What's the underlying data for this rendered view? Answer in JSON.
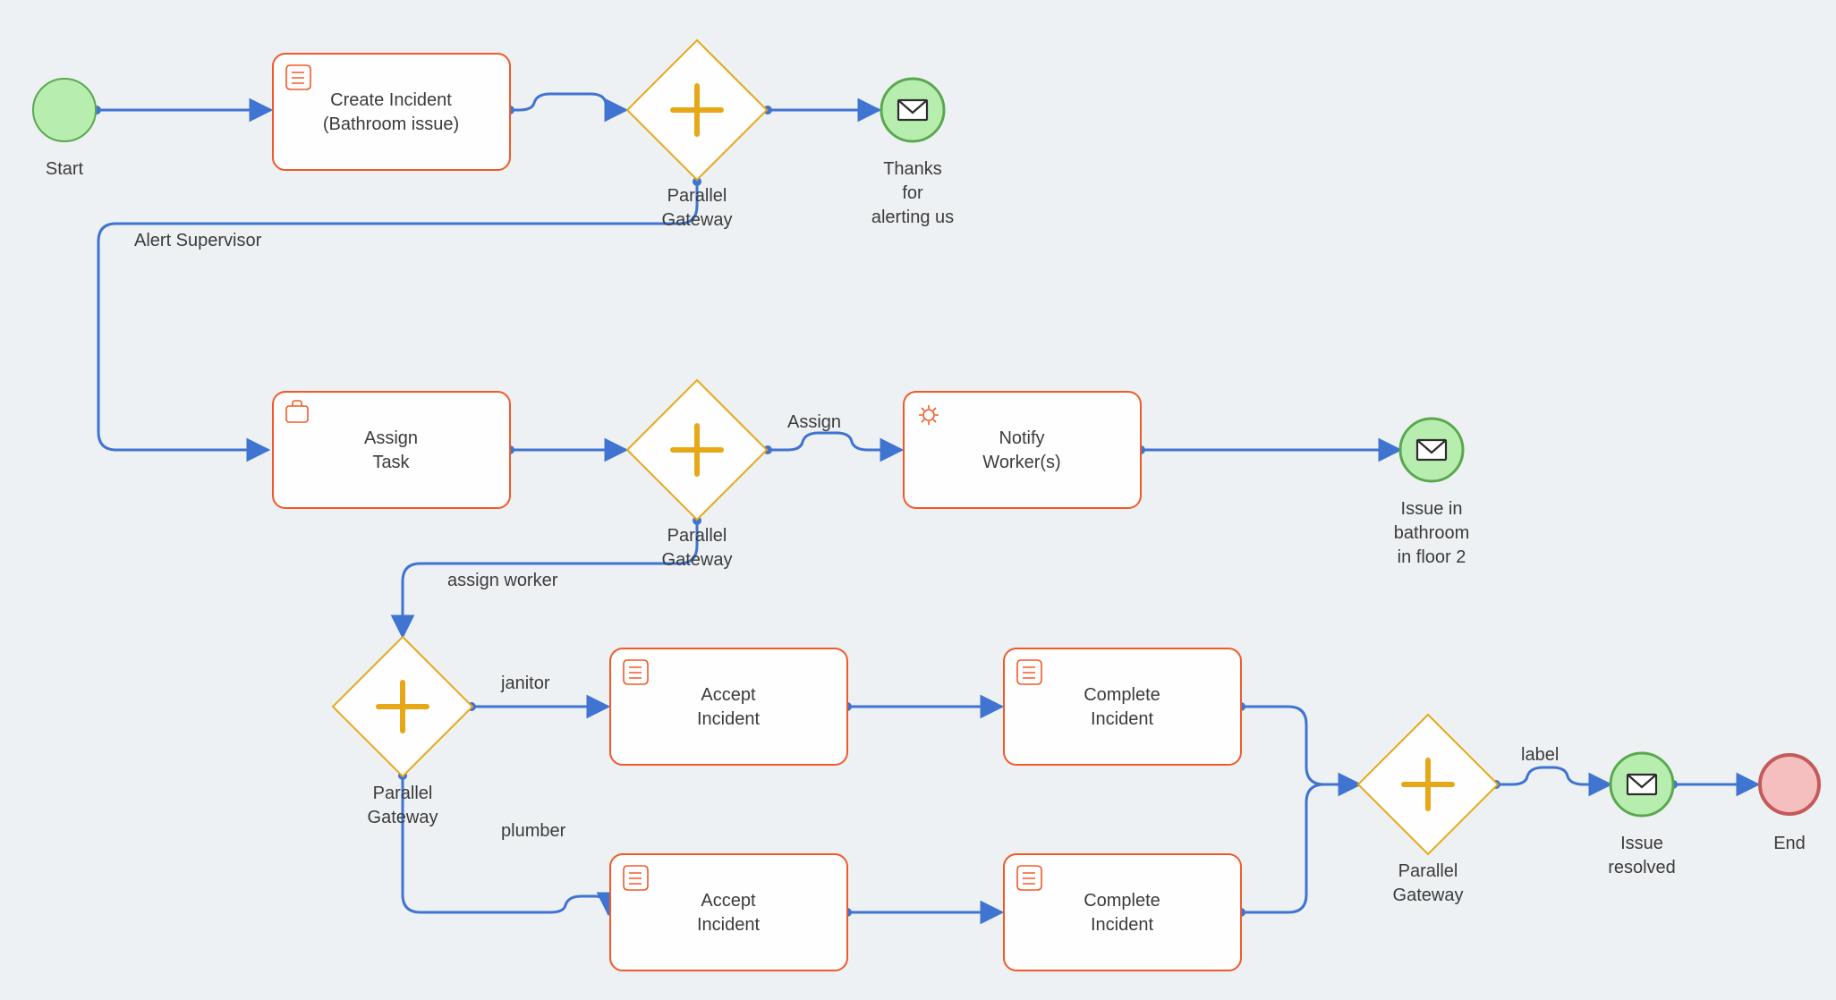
{
  "chart_data": {
    "type": "bpmn",
    "events": [
      {
        "id": "start",
        "kind": "start",
        "label": "Start"
      },
      {
        "id": "msg_thanks",
        "kind": "message",
        "label": "Thanks for alerting us"
      },
      {
        "id": "msg_issue",
        "kind": "message",
        "label": "Issue in bathroom in floor 2"
      },
      {
        "id": "msg_resolved",
        "kind": "message",
        "label": "Issue resolved"
      },
      {
        "id": "end",
        "kind": "end",
        "label": "End"
      }
    ],
    "tasks": [
      {
        "id": "create",
        "label": "Create Incident (Bathroom issue)",
        "icon": "script"
      },
      {
        "id": "assign",
        "label": "Assign Task",
        "icon": "manual"
      },
      {
        "id": "notify",
        "label": "Notify Worker(s)",
        "icon": "service"
      },
      {
        "id": "accept1",
        "label": "Accept Incident",
        "icon": "script"
      },
      {
        "id": "complete1",
        "label": "Complete Incident",
        "icon": "script"
      },
      {
        "id": "accept2",
        "label": "Accept Incident",
        "icon": "script"
      },
      {
        "id": "complete2",
        "label": "Complete Incident",
        "icon": "script"
      }
    ],
    "gateways": [
      {
        "id": "gw1",
        "kind": "parallel",
        "label": "Parallel Gateway"
      },
      {
        "id": "gw2",
        "kind": "parallel",
        "label": "Parallel Gateway"
      },
      {
        "id": "gw3",
        "kind": "parallel",
        "label": "Parallel Gateway"
      },
      {
        "id": "gw4",
        "kind": "parallel",
        "label": "Parallel Gateway"
      }
    ],
    "flows": [
      {
        "from": "start",
        "to": "create",
        "label": ""
      },
      {
        "from": "create",
        "to": "gw1",
        "label": ""
      },
      {
        "from": "gw1",
        "to": "msg_thanks",
        "label": ""
      },
      {
        "from": "gw1",
        "to": "assign",
        "label": "Alert Supervisor"
      },
      {
        "from": "assign",
        "to": "gw2",
        "label": ""
      },
      {
        "from": "gw2",
        "to": "notify",
        "label": "Assign"
      },
      {
        "from": "notify",
        "to": "msg_issue",
        "label": ""
      },
      {
        "from": "gw2",
        "to": "gw3",
        "label": "assign worker"
      },
      {
        "from": "gw3",
        "to": "accept1",
        "label": "janitor"
      },
      {
        "from": "gw3",
        "to": "accept2",
        "label": "plumber"
      },
      {
        "from": "accept1",
        "to": "complete1",
        "label": ""
      },
      {
        "from": "accept2",
        "to": "complete2",
        "label": ""
      },
      {
        "from": "complete1",
        "to": "gw4",
        "label": ""
      },
      {
        "from": "complete2",
        "to": "gw4",
        "label": ""
      },
      {
        "from": "gw4",
        "to": "msg_resolved",
        "label": "label"
      },
      {
        "from": "msg_resolved",
        "to": "end",
        "label": ""
      }
    ]
  },
  "labels": {
    "start": "Start",
    "create_l1": "Create Incident",
    "create_l2": "(Bathroom issue)",
    "gw": "Parallel",
    "gw2": "Gateway",
    "thanks_l1": "Thanks",
    "thanks_l2": "for",
    "thanks_l3": "alerting us",
    "alert_supervisor": "Alert Supervisor",
    "assign_l1": "Assign",
    "assign_l2": "Task",
    "edge_assign": "Assign",
    "notify_l1": "Notify",
    "notify_l2": "Worker(s)",
    "issue_l1": "Issue in",
    "issue_l2": "bathroom",
    "issue_l3": "in floor 2",
    "assign_worker": "assign worker",
    "janitor": "janitor",
    "plumber": "plumber",
    "accept_l1": "Accept",
    "accept_l2": "Incident",
    "complete_l1": "Complete",
    "complete_l2": "Incident",
    "edge_label": "label",
    "resolved_l1": "Issue",
    "resolved_l2": "resolved",
    "end": "End"
  }
}
